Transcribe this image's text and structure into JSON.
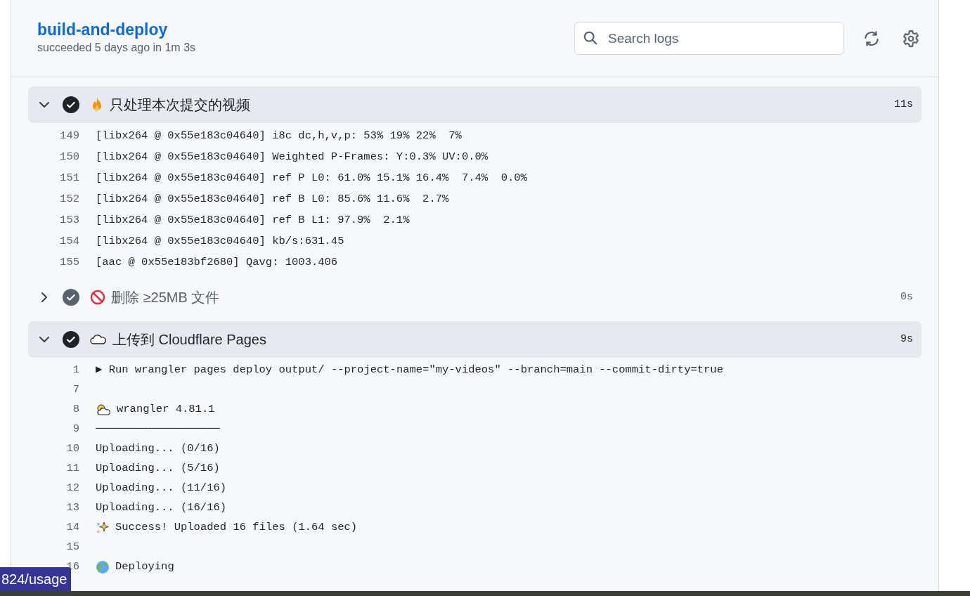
{
  "job": {
    "title": "build-and-deploy",
    "summary": "succeeded 5 days ago in 1m 3s"
  },
  "search": {
    "placeholder": "Search logs"
  },
  "steps": [
    {
      "title": "只处理本次提交的视频",
      "duration": "11s",
      "expanded": true,
      "lines": [
        {
          "number": "149",
          "text": "[libx264 @ 0x55e183c04640] i8c dc,h,v,p: 53% 19% 22%  7%"
        },
        {
          "number": "150",
          "text": "[libx264 @ 0x55e183c04640] Weighted P-Frames: Y:0.3% UV:0.0%"
        },
        {
          "number": "151",
          "text": "[libx264 @ 0x55e183c04640] ref P L0: 61.0% 15.1% 16.4%  7.4%  0.0%"
        },
        {
          "number": "152",
          "text": "[libx264 @ 0x55e183c04640] ref B L0: 85.6% 11.6%  2.7%"
        },
        {
          "number": "153",
          "text": "[libx264 @ 0x55e183c04640] ref B L1: 97.9%  2.1%"
        },
        {
          "number": "154",
          "text": "[libx264 @ 0x55e183c04640] kb/s:631.45"
        },
        {
          "number": "155",
          "text": "[aac @ 0x55e183bf2680] Qavg: 1003.406"
        }
      ]
    },
    {
      "title": "删除 ≥25MB 文件",
      "duration": "0s",
      "expanded": false
    },
    {
      "title": "上传到 Cloudflare Pages",
      "duration": "9s",
      "expanded": true,
      "lines": [
        {
          "number": "1",
          "text": "▶ Run wrangler pages deploy output/ --project-name=\"my-videos\" --branch=main --commit-dirty=true"
        },
        {
          "number": "7"
        },
        {
          "number": "8",
          "text": "wrangler 4.81.1"
        },
        {
          "number": "9",
          "text": "───────────────────"
        },
        {
          "number": "10",
          "text": "Uploading... (0/16)"
        },
        {
          "number": "11",
          "text": "Uploading... (5/16)"
        },
        {
          "number": "12",
          "text": "Uploading... (11/16)"
        },
        {
          "number": "13",
          "text": "Uploading... (16/16)"
        },
        {
          "number": "14",
          "text": "Success! Uploaded 16 files (1.64 sec)"
        },
        {
          "number": "15"
        },
        {
          "number": "16",
          "text": "Deploying"
        }
      ]
    }
  ],
  "link_preview": "824/usage"
}
